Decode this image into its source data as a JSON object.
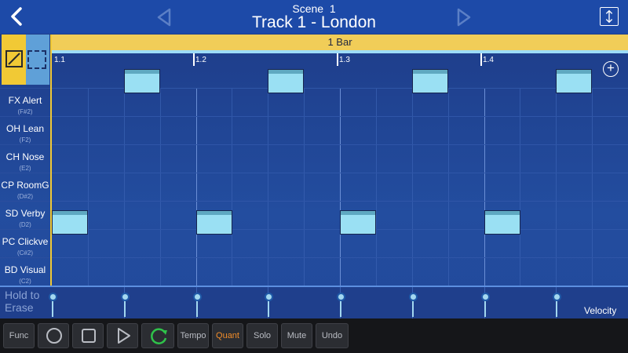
{
  "header": {
    "scene": "Scene  1",
    "title": "Track 1 - London"
  },
  "bar": {
    "label": "1 Bar"
  },
  "ruler": [
    "1.1",
    "1.2",
    "1.3",
    "1.4"
  ],
  "tracks": [
    {
      "name": "FX Alert",
      "note": "(F#2)"
    },
    {
      "name": "OH Lean",
      "note": "(F2)"
    },
    {
      "name": "CH Nose",
      "note": "(E2)"
    },
    {
      "name": "CP RoomG",
      "note": "(D#2)"
    },
    {
      "name": "SD Verby",
      "note": "(D2)"
    },
    {
      "name": "PC Clickve",
      "note": "(C#2)"
    },
    {
      "name": "BD Visual",
      "note": "(C2)"
    }
  ],
  "notes": [
    {
      "track": 1,
      "step": 2
    },
    {
      "track": 1,
      "step": 6
    },
    {
      "track": 1,
      "step": 10
    },
    {
      "track": 1,
      "step": 14
    },
    {
      "track": 6,
      "step": 0
    },
    {
      "track": 6,
      "step": 4
    },
    {
      "track": 6,
      "step": 8
    },
    {
      "track": 6,
      "step": 12
    }
  ],
  "velocity": {
    "erase_label": "Hold to\nErase",
    "label": "Velocity"
  },
  "toolbar": {
    "func": "Func",
    "tempo": "Tempo",
    "quant": "Quant",
    "solo": "Solo",
    "mute": "Mute",
    "undo": "Undo"
  },
  "colors": {
    "accent_yellow": "#f1c935",
    "note_fill": "#9ae0f3",
    "loop_green": "#2fc24a",
    "quant_active": "#f08c2a"
  }
}
